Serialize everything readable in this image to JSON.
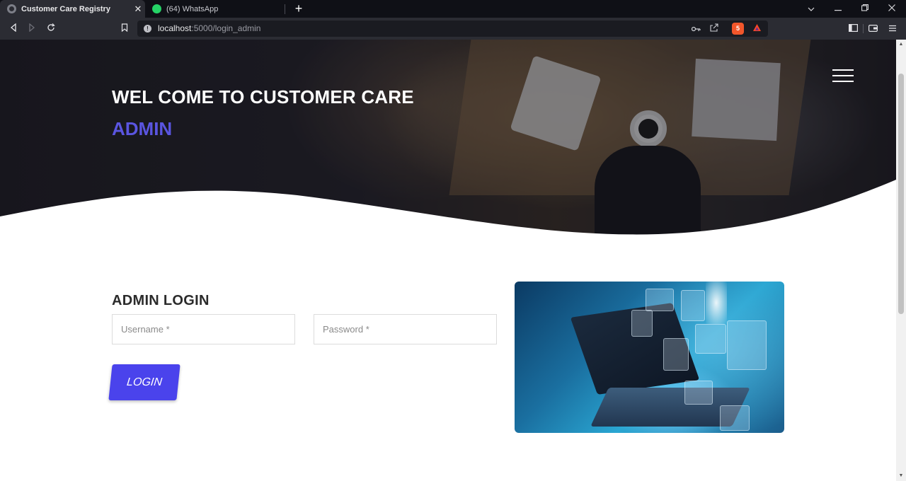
{
  "browser": {
    "tabs": [
      {
        "title": "Customer Care Registry",
        "active": true,
        "icon": "globe-icon"
      },
      {
        "title": "(64) WhatsApp",
        "active": false,
        "icon": "whatsapp-icon"
      }
    ],
    "close_glyph": "✕",
    "new_tab_glyph": "+",
    "url_host": "localhost",
    "url_path": ":5000/login_admin",
    "brave_badge": "5"
  },
  "hero": {
    "title": "WEL COME TO CUSTOMER CARE",
    "subtitle": "ADMIN",
    "menu_icon": "hamburger-icon"
  },
  "login": {
    "heading": "ADMIN LOGIN",
    "username_placeholder": "Username *",
    "password_placeholder": "Password *",
    "button_label": "LOGIN"
  },
  "colors": {
    "accent": "#4a43ec",
    "subtitle": "#5a55e0"
  }
}
